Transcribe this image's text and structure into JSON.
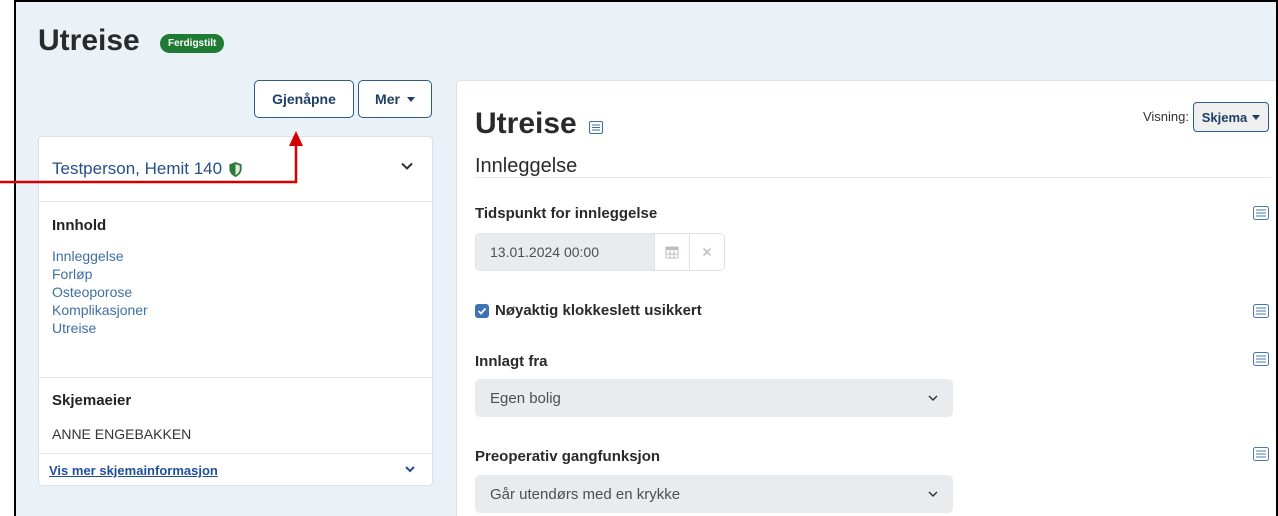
{
  "header": {
    "title": "Utreise",
    "badge": "Ferdigstilt"
  },
  "actions": {
    "reopen_label": "Gjenåpne",
    "more_label": "Mer"
  },
  "sidebar": {
    "person_name": "Testperson, Hemit 140",
    "contents_label": "Innhold",
    "contents": [
      "Innleggelse",
      "Forløp",
      "Osteoporose",
      "Komplikasjoner",
      "Utreise"
    ],
    "owner_label": "Skjemaeier",
    "owner_name": "ANNE ENGEBAKKEN",
    "more_info_link": "Vis mer skjemainformasjon"
  },
  "form": {
    "title": "Utreise",
    "view_label": "Visning:",
    "view_value": "Skjema",
    "section_title": "Innleggelse",
    "admission_time_label": "Tidspunkt for innleggelse",
    "admission_time_value": "13.01.2024 00:00",
    "exact_time_uncertain_label": "Nøyaktig klokkeslett usikkert",
    "exact_time_uncertain_checked": true,
    "admitted_from_label": "Innlagt fra",
    "admitted_from_value": "Egen bolig",
    "preop_walking_label": "Preoperativ gangfunksjon",
    "preop_walking_value": "Går utendørs med en krykke"
  },
  "colors": {
    "badge_green": "#1f7a34",
    "link_blue": "#3f6fa6",
    "accent_blue": "#2c5a8c",
    "annotation_red": "#d40000",
    "page_bg": "#eaf2f8"
  }
}
